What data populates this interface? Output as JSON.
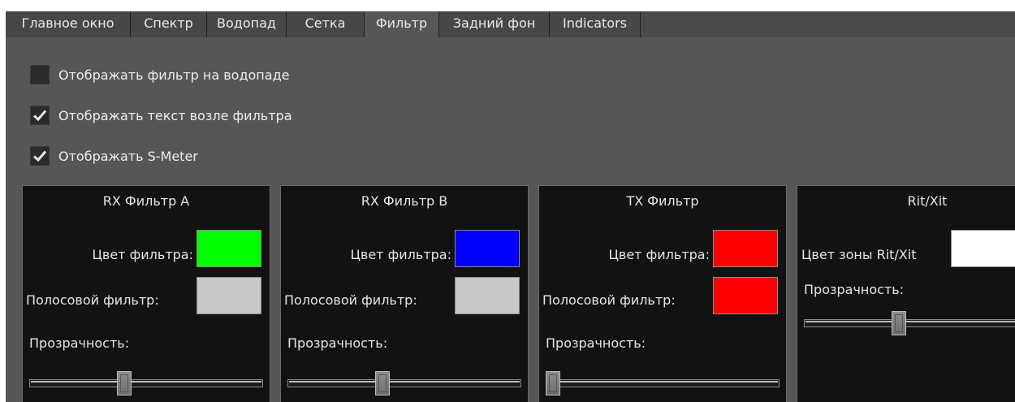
{
  "tabs": [
    {
      "label": "Главное окно",
      "active": false
    },
    {
      "label": "Спектр",
      "active": false
    },
    {
      "label": "Водопад",
      "active": false
    },
    {
      "label": "Сетка",
      "active": false
    },
    {
      "label": "Фильтр",
      "active": true
    },
    {
      "label": "Задний фон",
      "active": false
    },
    {
      "label": "Indicators",
      "active": false
    }
  ],
  "checkboxes": [
    {
      "label": "Отображать фильтр на водопаде",
      "checked": false
    },
    {
      "label": "Отображать текст возле фильтра",
      "checked": true
    },
    {
      "label": "Отображать S-Meter",
      "checked": true
    }
  ],
  "groups": [
    {
      "title": "RX Фильтр A",
      "color_label": "Цвет фильтра:",
      "filter_color": "#00ff00",
      "band_label": "Полосовой фильтр:",
      "band_color": "#c8c8c8",
      "transparency_label": "Прозрачность:",
      "transparency": 0.4
    },
    {
      "title": "RX Фильтр B",
      "color_label": "Цвет фильтра:",
      "filter_color": "#0000ff",
      "band_label": "Полосовой фильтр:",
      "band_color": "#c8c8c8",
      "transparency_label": "Прозрачность:",
      "transparency": 0.4
    },
    {
      "title": "TX Фильтр",
      "color_label": "Цвет фильтра:",
      "filter_color": "#ff0000",
      "band_label": "Полосовой фильтр:",
      "band_color": "#ff0000",
      "transparency_label": "Прозрачность:",
      "transparency": 0.0
    },
    {
      "title": "Rit/Xit",
      "color_label": "Цвет зоны Rit/Xit",
      "zone_color": "#ffffff",
      "transparency_label": "Прозрачность:",
      "transparency": 0.4
    }
  ]
}
